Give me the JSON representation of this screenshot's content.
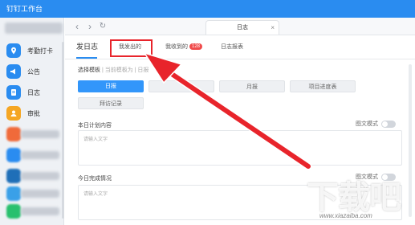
{
  "window": {
    "title": "钉钉工作台"
  },
  "sidebar": {
    "items": [
      {
        "label": "考勤打卡",
        "icon": "location-pin-icon",
        "color": "#2a8cf0"
      },
      {
        "label": "公告",
        "icon": "megaphone-icon",
        "color": "#2a8cf0"
      },
      {
        "label": "日志",
        "icon": "log-book-icon",
        "color": "#2a8cf0"
      },
      {
        "label": "审批",
        "icon": "approval-icon",
        "color": "#f5a623"
      }
    ],
    "blurred_colors": [
      "#f06a3a",
      "#2a8cf0",
      "#1f6fb8",
      "#3aa0e8",
      "#28c06e",
      "#9b59d0"
    ]
  },
  "browser": {
    "tab_title": "日志",
    "close_glyph": "×"
  },
  "tabs": {
    "items": [
      {
        "label": "发日志"
      },
      {
        "label": "我发出的"
      },
      {
        "label": "我收到的",
        "badge": "128"
      },
      {
        "label": "日志报表"
      }
    ]
  },
  "template": {
    "label": "选择模板",
    "sub": "| 当前模板为 | 日报",
    "buttons": [
      "日报",
      "周报",
      "月报",
      "项目进度表",
      "拜访记录"
    ]
  },
  "fields": [
    {
      "label": "本日计划内容",
      "placeholder": "请输入文字",
      "mode": "图文模式"
    },
    {
      "label": "今日完成情况",
      "placeholder": "请输入文字",
      "mode": "图文模式"
    }
  ],
  "watermark": {
    "brand": "下载吧",
    "url": "www.xiazaiba.com"
  },
  "colors": {
    "accent": "#2a8cf0",
    "highlight": "#e8242b",
    "badge": "#f04b4b"
  }
}
